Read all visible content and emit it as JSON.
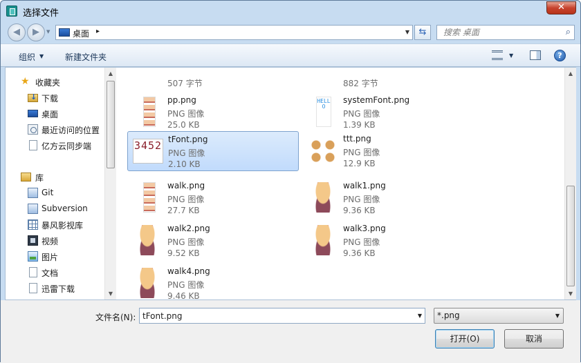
{
  "window": {
    "title": "选择文件",
    "close_glyph": "✕"
  },
  "address": {
    "location": "桌面",
    "separator_glyph": "▸"
  },
  "search": {
    "placeholder": "搜索 桌面"
  },
  "toolbar": {
    "organize_label": "组织",
    "new_folder_label": "新建文件夹"
  },
  "nav": {
    "favorites_label": "收藏夹",
    "favorites": [
      "下载",
      "桌面",
      "最近访问的位置",
      "亿方云同步端"
    ],
    "libraries_label": "库",
    "libraries": [
      "Git",
      "Subversion",
      "暴风影视库",
      "视频",
      "图片",
      "文档",
      "迅雷下载"
    ]
  },
  "files": [
    {
      "name": "",
      "type": "",
      "size": "507 字节",
      "thumb": "partial"
    },
    {
      "name": "",
      "type": "",
      "size": "882 字节",
      "thumb": "partial"
    },
    {
      "name": "pp.png",
      "type": "PNG 图像",
      "size": "25.0 KB",
      "thumb": "strip"
    },
    {
      "name": "systemFont.png",
      "type": "PNG 图像",
      "size": "1.39 KB",
      "thumb": "sys"
    },
    {
      "name": "tFont.png",
      "type": "PNG 图像",
      "size": "2.10 KB",
      "thumb": "font",
      "selected": true
    },
    {
      "name": "ttt.png",
      "type": "PNG 图像",
      "size": "12.9 KB",
      "thumb": "grid4"
    },
    {
      "name": "walk.png",
      "type": "PNG 图像",
      "size": "27.7 KB",
      "thumb": "strip"
    },
    {
      "name": "walk1.png",
      "type": "PNG 图像",
      "size": "9.36 KB",
      "thumb": "girl"
    },
    {
      "name": "walk2.png",
      "type": "PNG 图像",
      "size": "9.52 KB",
      "thumb": "girl"
    },
    {
      "name": "walk3.png",
      "type": "PNG 图像",
      "size": "9.36 KB",
      "thumb": "girl"
    },
    {
      "name": "walk4.png",
      "type": "PNG 图像",
      "size": "9.46 KB",
      "thumb": "girl"
    }
  ],
  "thumb_text": {
    "font": "3452",
    "sys": "HELLO"
  },
  "bottom": {
    "filename_label": "文件名(N):",
    "filename_value": "tFont.png",
    "filter_value": "*.png",
    "open_label": "打开(O)",
    "cancel_label": "取消"
  },
  "colors": {
    "selection": "#c1dbfc",
    "frame": "#c7dcf1",
    "close": "#c7432e"
  }
}
